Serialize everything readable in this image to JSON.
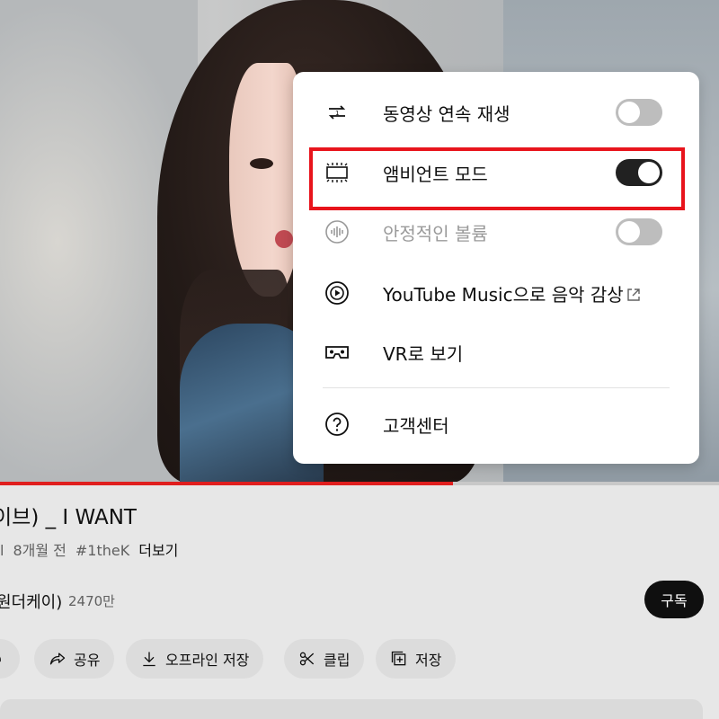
{
  "video": {
    "progress_fraction": 0.63
  },
  "info": {
    "title": "이브) _ I WANT",
    "meta_divider": "l",
    "meta_time": "8개월 전",
    "meta_hashtag": "#1theK",
    "meta_more": "더보기",
    "channel_name": "원더케이)",
    "subscriber_count": "2470만",
    "subscribe_label": "구독"
  },
  "actions": {
    "share": "공유",
    "download": "오프라인 저장",
    "clip": "클립",
    "save": "저장"
  },
  "menu": {
    "autoplay": {
      "label": "동영상 연속 재생",
      "state": "off",
      "icon": "autoplay-icon"
    },
    "ambient": {
      "label": "앰비언트 모드",
      "state": "on",
      "icon": "ambient-mode-icon"
    },
    "stable_volume": {
      "label": "안정적인 볼륨",
      "state": "off",
      "icon": "stable-volume-icon"
    },
    "music": {
      "label": "YouTube Music으로 음악 감상",
      "icon": "youtube-music-icon"
    },
    "vr": {
      "label": "VR로 보기",
      "icon": "vr-icon"
    },
    "help": {
      "label": "고객센터",
      "icon": "help-icon"
    }
  },
  "colors": {
    "highlight": "#e8141c",
    "progress": "#e01e1e",
    "toggle_on": "#212121",
    "toggle_off": "#bdbdbd"
  }
}
